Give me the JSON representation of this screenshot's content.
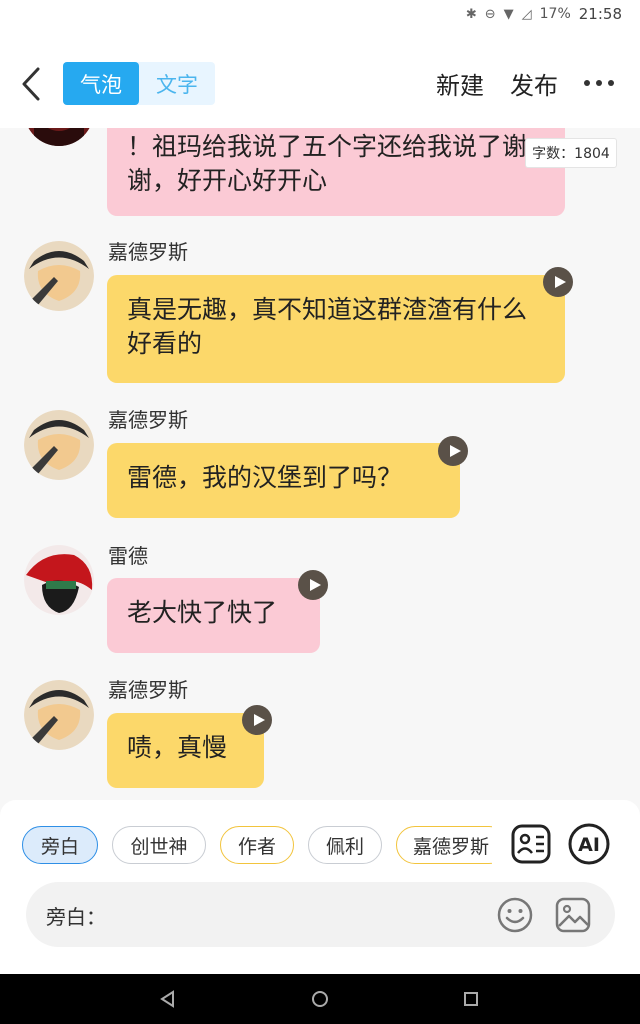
{
  "status_bar": {
    "battery": "17%",
    "time": "21:58"
  },
  "header": {
    "mode_tabs": [
      "气泡",
      "文字"
    ],
    "new_label": "新建",
    "publish_label": "发布"
  },
  "word_count": "字数：1804",
  "messages": [
    {
      "speaker": "",
      "text": "！祖玛给我说了五个字还给我说了谢谢，好开心好开心",
      "color": "pink"
    },
    {
      "speaker": "嘉德罗斯",
      "text": "真是无趣，真不知道这群渣渣有什么好看的",
      "color": "yellow"
    },
    {
      "speaker": "嘉德罗斯",
      "text": "雷德，我的汉堡到了吗？",
      "color": "yellow"
    },
    {
      "speaker": "雷德",
      "text": "老大快了快了",
      "color": "pink"
    },
    {
      "speaker": "嘉德罗斯",
      "text": "啧，真慢",
      "color": "yellow"
    }
  ],
  "chips": [
    "旁白",
    "创世神",
    "作者",
    "佩利",
    "嘉德罗斯"
  ],
  "ai_label": "AI",
  "input": {
    "label": "旁白：",
    "value": ""
  },
  "colors": {
    "accent": "#26a9f0",
    "pink_bubble": "#fbcad5",
    "yellow_bubble": "#fcd86a"
  }
}
